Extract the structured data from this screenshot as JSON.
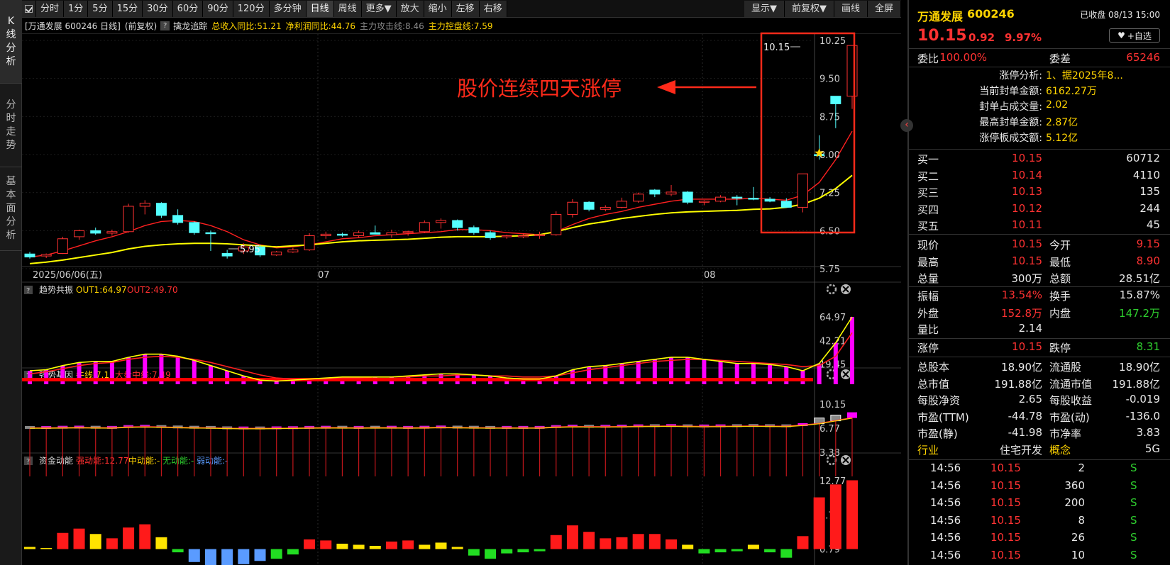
{
  "nav": {
    "tabs": [
      {
        "label": "K线分析"
      },
      {
        "label": "分时走势"
      },
      {
        "label": "基本面分析"
      }
    ]
  },
  "toolbar": {
    "periods": [
      "分时",
      "1分",
      "5分",
      "15分",
      "30分",
      "60分",
      "90分",
      "120分",
      "多分钟",
      "日线",
      "周线",
      "更多▼",
      "放大",
      "缩小",
      "左移",
      "右移"
    ],
    "active": "日线",
    "right": [
      "显示▼",
      "前复权▼",
      "画线",
      "全屏"
    ]
  },
  "chart_info": {
    "stock": "[万通发展 600246 日线]",
    "adjust": "(前复权)",
    "indicator_name": "擒龙追踪",
    "revenue": "总收入同比:51.21",
    "profit": "净利润同比:44.76",
    "attack": "主力攻击线:8.46",
    "control": "主力控盘线:7.59"
  },
  "colors": {
    "up": "#ff3232",
    "down": "#54ffff",
    "ma_yellow": "#ffff00",
    "ma_red": "#ff2020",
    "ma_grey": "#9a9a9a",
    "magenta": "#ff00ff",
    "annotation": "#ff2a1a"
  },
  "annotation": {
    "text": "股价连续四天涨停"
  },
  "main_axis": {
    "ticks": [
      "10.25",
      "9.50",
      "8.75",
      "8.00",
      "7.25",
      "6.50",
      "5.75"
    ],
    "ticks_values": [
      10.25,
      9.5,
      8.75,
      8.0,
      7.25,
      6.5,
      5.75
    ]
  },
  "date_axis": {
    "labels": [
      "2025/06/06(五)",
      "07",
      "08"
    ]
  },
  "price_labels": {
    "high": "10.15",
    "low": "5.95"
  },
  "indicators": {
    "trend": {
      "name": "趋势共振",
      "out1": "OUT1:64.97",
      "out2": "OUT2:49.70",
      "ticks": [
        "64.97",
        "42.21",
        "19.45"
      ]
    },
    "strong": {
      "name": "强势基因",
      "bull": "牛线:7.15",
      "mid": "大盘中线:7.49",
      "ticks": [
        "10.15",
        "6.77",
        "3.38"
      ]
    },
    "fund": {
      "name": "资金动能",
      "strong": "强动能:12.77",
      "mid": "中动能:-",
      "none": "无动能:-",
      "weak": "弱动能:-",
      "ticks": [
        "12.77",
        "6.78",
        "0.79"
      ]
    }
  },
  "chart_data": {
    "type": "candlestick",
    "ohlc": [
      [
        6.04,
        6.08,
        5.95,
        5.98
      ],
      [
        6.0,
        6.05,
        5.96,
        6.03
      ],
      [
        6.05,
        6.38,
        6.04,
        6.34
      ],
      [
        6.38,
        6.52,
        6.32,
        6.5
      ],
      [
        6.5,
        6.56,
        6.42,
        6.45
      ],
      [
        6.45,
        6.52,
        6.4,
        6.48
      ],
      [
        6.48,
        7.03,
        6.46,
        6.98
      ],
      [
        6.98,
        7.1,
        6.82,
        7.04
      ],
      [
        7.04,
        7.06,
        6.75,
        6.8
      ],
      [
        6.8,
        6.92,
        6.62,
        6.66
      ],
      [
        6.66,
        6.68,
        6.42,
        6.46
      ],
      [
        6.46,
        6.5,
        6.1,
        6.45
      ],
      [
        6.05,
        6.12,
        5.95,
        6.0
      ],
      [
        6.1,
        6.25,
        6.04,
        6.18
      ],
      [
        6.18,
        6.22,
        5.98,
        6.02
      ],
      [
        6.02,
        6.1,
        6.0,
        6.08
      ],
      [
        6.08,
        6.16,
        6.06,
        6.12
      ],
      [
        6.12,
        6.45,
        6.1,
        6.4
      ],
      [
        6.4,
        6.48,
        6.34,
        6.43
      ],
      [
        6.43,
        6.46,
        6.38,
        6.41
      ],
      [
        6.4,
        6.5,
        6.36,
        6.46
      ],
      [
        6.46,
        6.6,
        6.43,
        6.43
      ],
      [
        6.42,
        6.52,
        6.36,
        6.46
      ],
      [
        6.46,
        6.5,
        6.4,
        6.48
      ],
      [
        6.48,
        6.7,
        6.45,
        6.66
      ],
      [
        6.66,
        6.74,
        6.54,
        6.7
      ],
      [
        6.7,
        6.72,
        6.5,
        6.56
      ],
      [
        6.56,
        6.6,
        6.42,
        6.46
      ],
      [
        6.46,
        6.5,
        6.32,
        6.36
      ],
      [
        6.38,
        6.42,
        6.34,
        6.4
      ],
      [
        6.4,
        6.45,
        6.35,
        6.4
      ],
      [
        6.4,
        6.48,
        6.34,
        6.42
      ],
      [
        6.42,
        6.88,
        6.4,
        6.82
      ],
      [
        6.82,
        7.12,
        6.76,
        7.06
      ],
      [
        7.06,
        7.08,
        6.88,
        6.92
      ],
      [
        6.92,
        7.0,
        6.88,
        6.96
      ],
      [
        6.96,
        7.15,
        6.94,
        7.08
      ],
      [
        7.08,
        7.25,
        7.05,
        7.22
      ],
      [
        7.3,
        7.32,
        7.16,
        7.22
      ],
      [
        7.22,
        7.4,
        7.18,
        7.26
      ],
      [
        7.26,
        7.28,
        7.02,
        7.06
      ],
      [
        7.06,
        7.1,
        7.0,
        7.08
      ],
      [
        7.08,
        7.2,
        7.06,
        7.16
      ],
      [
        7.16,
        7.2,
        7.0,
        7.14
      ],
      [
        7.14,
        7.36,
        7.1,
        7.12
      ],
      [
        7.12,
        7.16,
        7.06,
        7.08
      ],
      [
        7.08,
        7.14,
        6.96,
        6.96
      ],
      [
        6.96,
        7.62,
        6.86,
        7.62
      ],
      [
        8.0,
        8.38,
        7.9,
        7.98
      ],
      [
        9.15,
        9.15,
        8.52,
        9.0
      ],
      [
        9.15,
        10.15,
        8.9,
        10.15
      ]
    ],
    "ma_yellow": [
      5.85,
      5.88,
      5.92,
      5.97,
      6.02,
      6.07,
      6.14,
      6.19,
      6.22,
      6.24,
      6.25,
      6.25,
      6.24,
      6.22,
      6.2,
      6.18,
      6.2,
      6.22,
      6.25,
      6.28,
      6.3,
      6.31,
      6.32,
      6.33,
      6.35,
      6.37,
      6.38,
      6.38,
      6.38,
      6.39,
      6.4,
      6.42,
      6.48,
      6.56,
      6.63,
      6.68,
      6.74,
      6.78,
      6.82,
      6.85,
      6.87,
      6.88,
      6.89,
      6.9,
      6.92,
      6.93,
      6.96,
      7.02,
      7.14,
      7.33,
      7.59
    ],
    "ma_red": [
      5.98,
      6.02,
      6.1,
      6.2,
      6.3,
      6.38,
      6.48,
      6.6,
      6.68,
      6.7,
      6.68,
      6.6,
      6.48,
      6.32,
      6.22,
      6.16,
      6.18,
      6.22,
      6.28,
      6.34,
      6.36,
      6.4,
      6.42,
      6.44,
      6.46,
      6.48,
      6.52,
      6.52,
      6.5,
      6.46,
      6.44,
      6.42,
      6.48,
      6.62,
      6.74,
      6.82,
      6.88,
      6.96,
      7.02,
      7.08,
      7.12,
      7.12,
      7.12,
      7.12,
      7.14,
      7.12,
      7.1,
      7.2,
      7.45,
      7.9,
      8.46
    ],
    "trend_out1": [
      13,
      14,
      18,
      21,
      22,
      22,
      26,
      29,
      29,
      27,
      23,
      18,
      13,
      8,
      4,
      3,
      4,
      5,
      6,
      7,
      7,
      7,
      7,
      8,
      9,
      10,
      10,
      9,
      8,
      6,
      5,
      5,
      8,
      14,
      17,
      18,
      20,
      22,
      24,
      26,
      26,
      24,
      22,
      20,
      20,
      19,
      17,
      13,
      20,
      40,
      64.97
    ],
    "trend_out2": [
      10,
      12,
      15,
      18,
      20,
      21,
      24,
      26,
      27,
      26,
      24,
      21,
      17,
      13,
      9,
      6,
      5,
      5,
      5,
      6,
      6,
      7,
      7,
      7,
      8,
      8,
      9,
      9,
      8,
      8,
      7,
      7,
      8,
      11,
      14,
      16,
      18,
      20,
      22,
      23,
      24,
      24,
      23,
      22,
      21,
      20,
      19,
      17,
      18,
      27,
      49.7
    ],
    "fund_bars": [
      0.4,
      0.2,
      3.0,
      3.8,
      2.8,
      2.0,
      4.0,
      4.6,
      2.2,
      -0.6,
      -2.4,
      -3.4,
      -5.0,
      -2.8,
      -2.2,
      -1.8,
      -1.0,
      1.8,
      1.6,
      1.0,
      0.8,
      0.6,
      1.4,
      1.6,
      0.8,
      1.2,
      0.4,
      -1.2,
      -1.8,
      -0.8,
      -0.6,
      -0.4,
      2.6,
      4.4,
      3.2,
      2.0,
      2.2,
      2.8,
      2.8,
      1.8,
      0.8,
      -0.8,
      -0.6,
      -0.4,
      0.8,
      -0.6,
      -1.6,
      2.4,
      9.6,
      12.0,
      12.77
    ],
    "strong_vals": [
      6.77,
      6.77,
      6.8,
      6.82,
      6.8,
      6.78,
      6.9,
      6.94,
      6.9,
      6.84,
      6.8,
      6.78,
      6.72,
      6.7,
      6.7,
      6.72,
      6.74,
      6.78,
      6.8,
      6.8,
      6.78,
      6.8,
      6.8,
      6.78,
      6.8,
      6.84,
      6.82,
      6.8,
      6.78,
      6.78,
      6.78,
      6.78,
      6.9,
      6.96,
      6.94,
      6.94,
      6.96,
      7.0,
      7.02,
      7.04,
      7.0,
      6.98,
      7.0,
      7.02,
      7.04,
      7.02,
      7.0,
      7.16,
      7.4,
      7.8,
      8.2
    ]
  },
  "right": {
    "name": "万通发展",
    "code": "600246",
    "status": "已收盘 08/13 15:00",
    "price": "10.15",
    "change": "0.92",
    "pct": "9.97%",
    "watch": "+自选",
    "weibi_label": "委比",
    "weibi": "100.00%",
    "weicha_label": "委差",
    "weicha": "65246",
    "limit_info": [
      {
        "k": "涨停分析:",
        "v": "1、据2025年8..."
      },
      {
        "k": "当前封单金额:",
        "v": "6162.27万"
      },
      {
        "k": "封单占成交量:",
        "v": "2.02"
      },
      {
        "k": "最高封单金额:",
        "v": "2.87亿"
      },
      {
        "k": "涨停板成交额:",
        "v": "5.12亿"
      }
    ],
    "bids": [
      {
        "label": "买一",
        "price": "10.15",
        "vol": "60712"
      },
      {
        "label": "买二",
        "price": "10.14",
        "vol": "4110"
      },
      {
        "label": "买三",
        "price": "10.13",
        "vol": "135"
      },
      {
        "label": "买四",
        "price": "10.12",
        "vol": "244"
      },
      {
        "label": "买五",
        "price": "10.11",
        "vol": "45"
      }
    ],
    "quote": [
      {
        "l1": "现价",
        "v1": "10.15",
        "c1": "red",
        "l2": "今开",
        "v2": "9.15",
        "c2": "red"
      },
      {
        "l1": "最高",
        "v1": "10.15",
        "c1": "red",
        "l2": "最低",
        "v2": "8.90",
        "c2": "red"
      },
      {
        "l1": "总量",
        "v1": "300万",
        "c1": "white",
        "l2": "总额",
        "v2": "28.51亿",
        "c2": "white"
      }
    ],
    "stats": [
      {
        "l1": "振幅",
        "v1": "13.54%",
        "c1": "red",
        "l2": "换手",
        "v2": "15.87%",
        "c2": "white"
      },
      {
        "l1": "外盘",
        "v1": "152.8万",
        "c1": "red",
        "l2": "内盘",
        "v2": "147.2万",
        "c2": "green"
      },
      {
        "l1": "量比",
        "v1": "2.14",
        "c1": "white",
        "l2": "",
        "v2": "",
        "c2": "white"
      }
    ],
    "limits": {
      "up_label": "涨停",
      "up": "10.15",
      "down_label": "跌停",
      "down": "8.31"
    },
    "fundamentals": [
      {
        "l1": "总股本",
        "v1": "18.90亿",
        "l2": "流通股",
        "v2": "18.90亿"
      },
      {
        "l1": "总市值",
        "v1": "191.88亿",
        "l2": "流通市值",
        "v2": "191.88亿"
      },
      {
        "l1": "每股净资",
        "v1": "2.65",
        "l2": "每股收益",
        "v2": "-0.019"
      },
      {
        "l1": "市盈(TTM)",
        "v1": "-44.78",
        "l2": "市盈(动)",
        "v2": "-136.0"
      },
      {
        "l1": "市盈(静)",
        "v1": "-41.98",
        "l2": "市净率",
        "v2": "3.83"
      }
    ],
    "industry_label": "行业",
    "industry": "住宅开发",
    "concept_label": "概念",
    "concept": "5G",
    "ticks": [
      {
        "t": "14:56",
        "p": "10.15",
        "v": "2",
        "s": "S"
      },
      {
        "t": "14:56",
        "p": "10.15",
        "v": "360",
        "s": "S"
      },
      {
        "t": "14:56",
        "p": "10.15",
        "v": "200",
        "s": "S"
      },
      {
        "t": "14:56",
        "p": "10.15",
        "v": "8",
        "s": "S"
      },
      {
        "t": "14:56",
        "p": "10.15",
        "v": "26",
        "s": "S"
      },
      {
        "t": "14:56",
        "p": "10.15",
        "v": "10",
        "s": "S"
      }
    ]
  }
}
